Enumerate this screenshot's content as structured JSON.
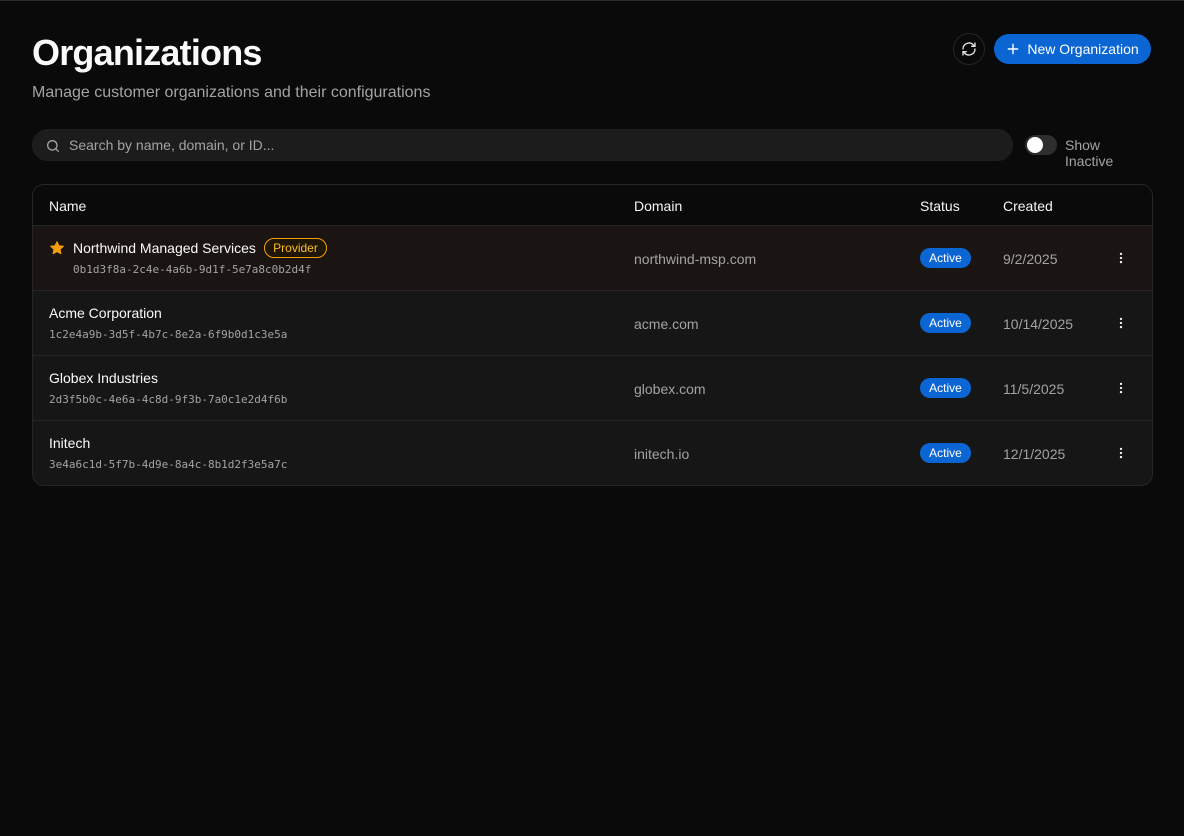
{
  "header": {
    "title": "Organizations",
    "subtitle": "Manage customer organizations and their configurations",
    "new_button_label": "New Organization"
  },
  "search": {
    "placeholder": "Search by name, domain, or ID...",
    "value": ""
  },
  "filters": {
    "show_inactive_label": "Show Inactive",
    "show_inactive_on": false
  },
  "table": {
    "columns": {
      "name": "Name",
      "domain": "Domain",
      "status": "Status",
      "created": "Created"
    },
    "rows": [
      {
        "name": "Northwind Managed Services",
        "badge": "Provider",
        "id": "0b1d3f8a-2c4e-4a6b-9d1f-5e7a8c0b2d4f",
        "domain": "northwind-msp.com",
        "status": "Active",
        "created": "9/2/2025"
      },
      {
        "name": "Acme Corporation",
        "id": "1c2e4a9b-3d5f-4b7c-8e2a-6f9b0d1c3e5a",
        "domain": "acme.com",
        "status": "Active",
        "created": "10/14/2025"
      },
      {
        "name": "Globex Industries",
        "id": "2d3f5b0c-4e6a-4c8d-9f3b-7a0c1e2d4f6b",
        "domain": "globex.com",
        "status": "Active",
        "created": "11/5/2025"
      },
      {
        "name": "Initech",
        "id": "3e4a6c1d-5f7b-4d9e-8a4c-8b1d2f3e5a7c",
        "domain": "initech.io",
        "status": "Active",
        "created": "12/1/2025"
      }
    ]
  },
  "colors": {
    "background": "#0a0a0a",
    "accent": "#0b66d4",
    "provider": "#f59e0b"
  },
  "icons": {
    "refresh": "refresh-icon",
    "plus": "plus-icon",
    "search": "search-icon",
    "star": "star-icon",
    "menu": "more-vertical-icon"
  }
}
